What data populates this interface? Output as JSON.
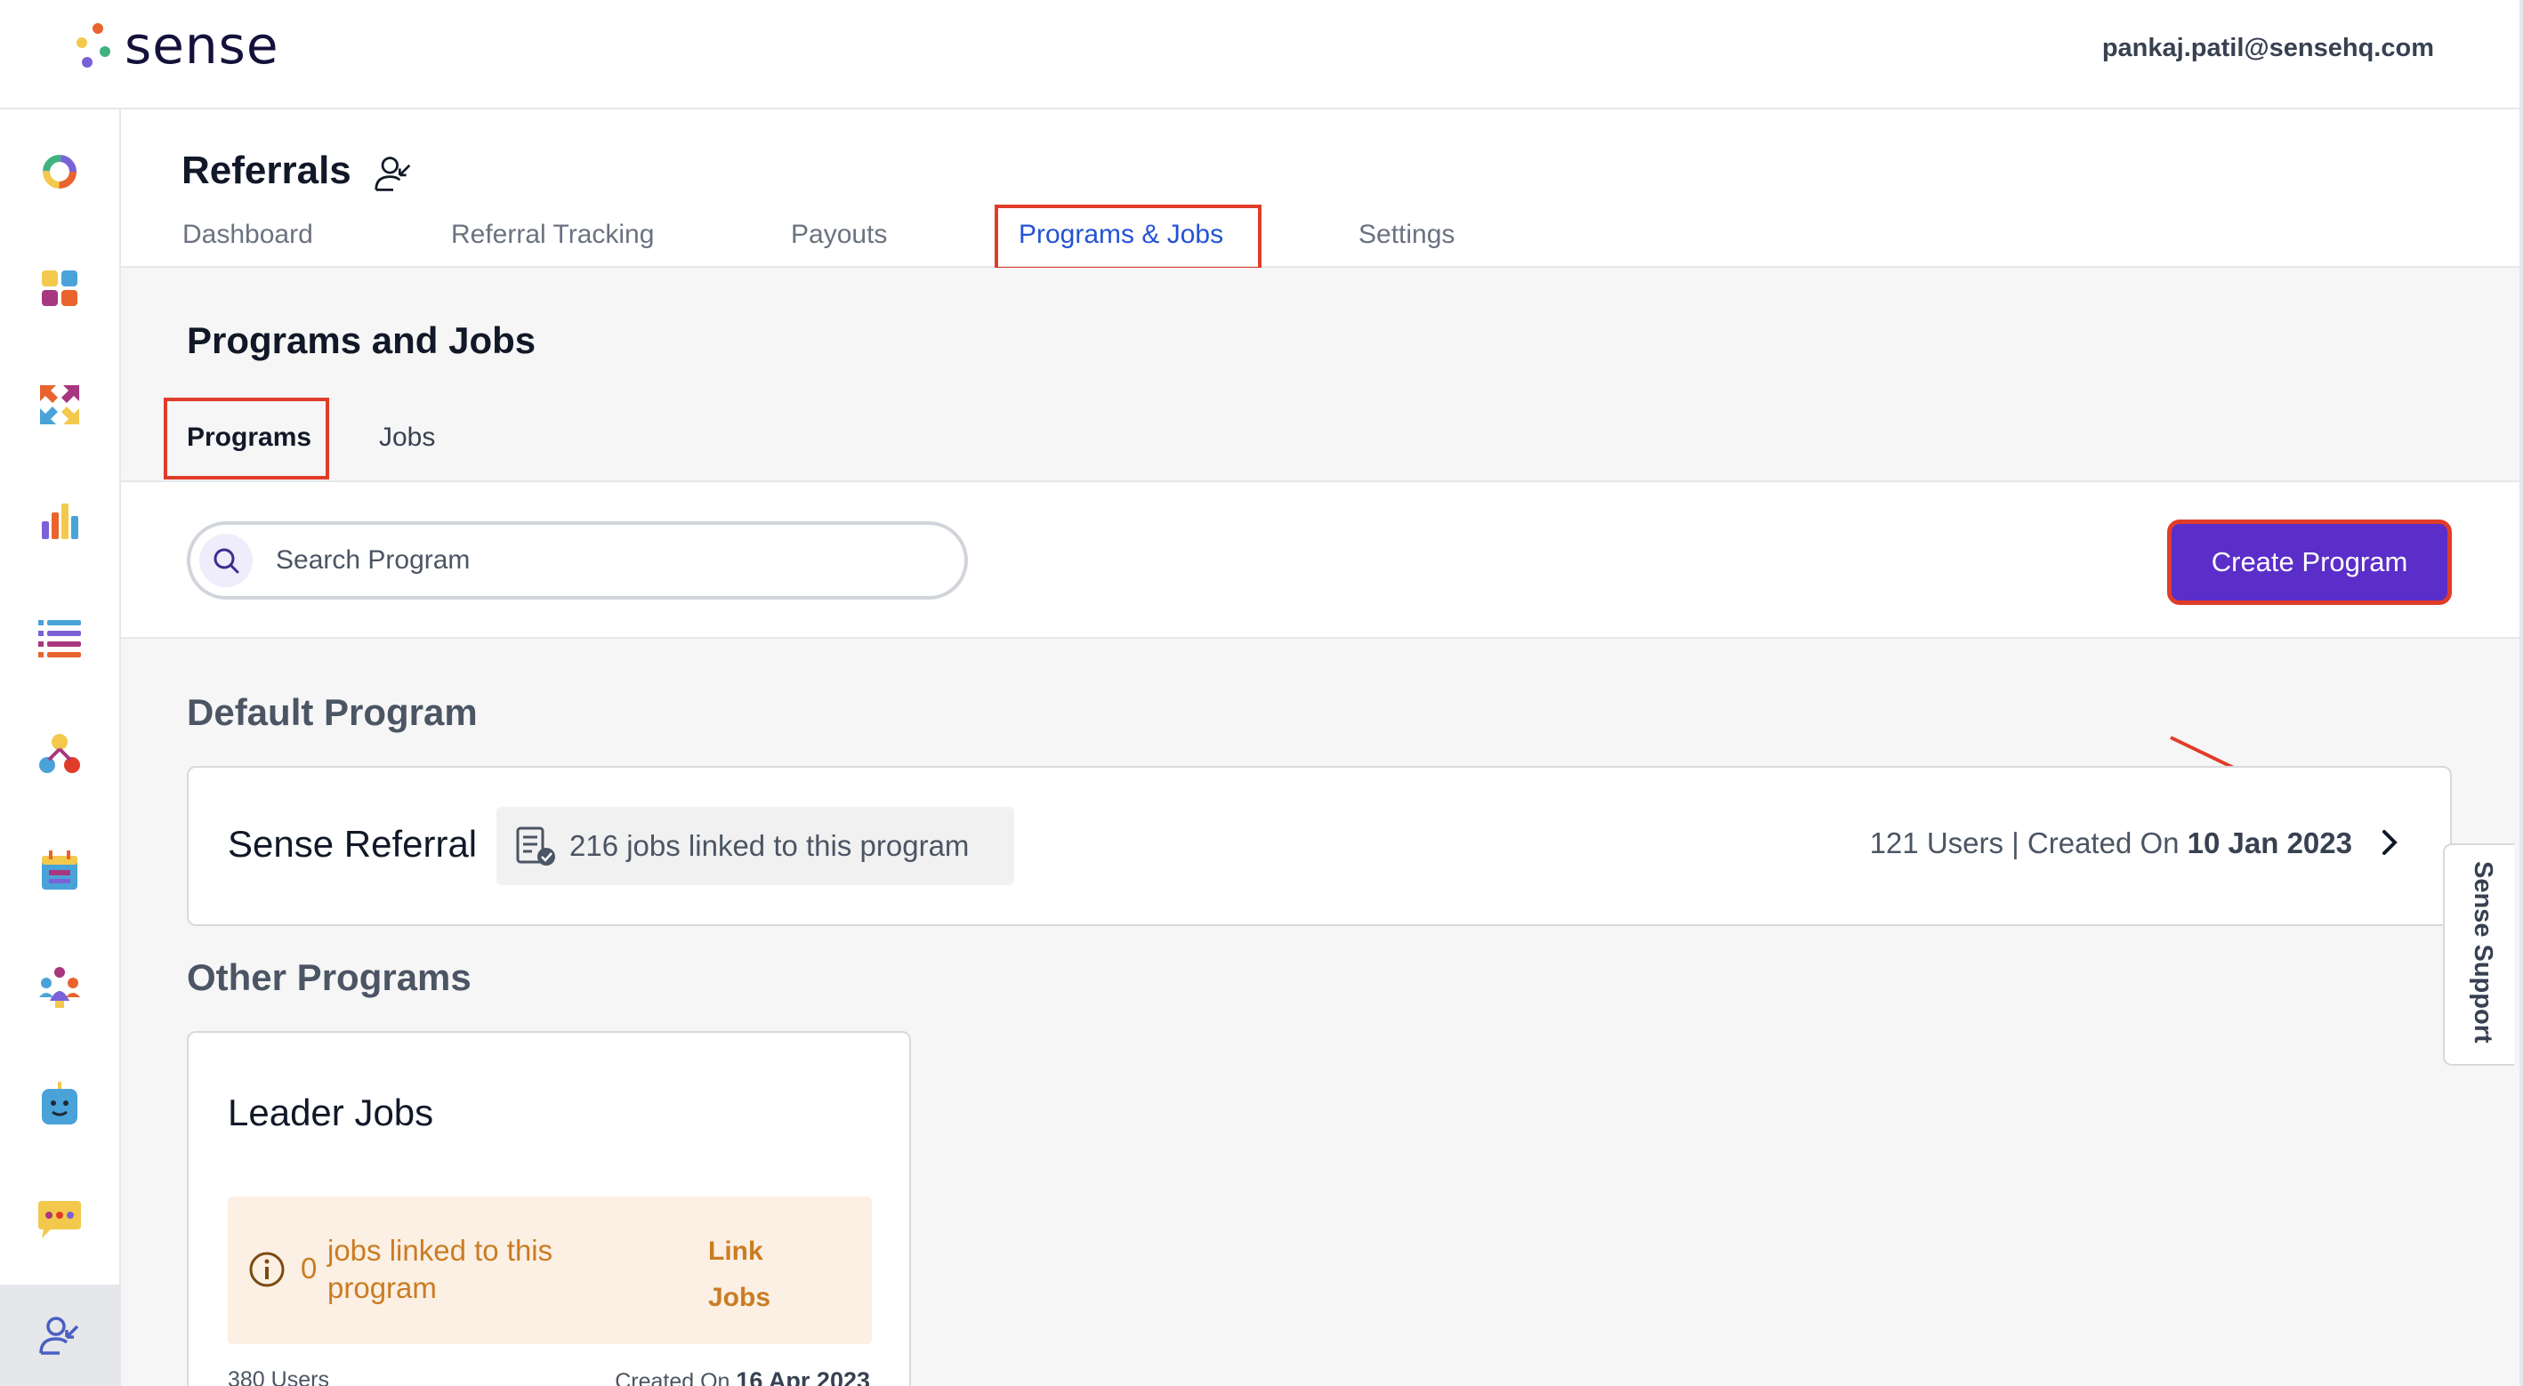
{
  "header": {
    "logo_text": "sense",
    "user_email": "pankaj.patil@sensehq.com"
  },
  "sidebar": {
    "items": [
      {
        "icon": "donut-chart-icon"
      },
      {
        "icon": "apps-grid-icon"
      },
      {
        "icon": "arrows-exchange-icon"
      },
      {
        "icon": "bar-chart-icon"
      },
      {
        "icon": "list-icon"
      },
      {
        "icon": "people-network-icon"
      },
      {
        "icon": "calendar-icon"
      },
      {
        "icon": "community-icon"
      },
      {
        "icon": "chatbot-icon"
      },
      {
        "icon": "chat-bubble-icon"
      },
      {
        "icon": "referral-user-icon",
        "active": true
      }
    ]
  },
  "page": {
    "title": "Referrals",
    "tabs": [
      "Dashboard",
      "Referral Tracking",
      "Payouts",
      "Programs & Jobs",
      "Settings"
    ],
    "active_tab": "Programs & Jobs"
  },
  "main": {
    "section_title": "Programs and Jobs",
    "subtabs": [
      "Programs",
      "Jobs"
    ],
    "active_subtab": "Programs",
    "search": {
      "placeholder": "Search Program",
      "value": ""
    },
    "create_button": "Create Program",
    "default_group_title": "Default Program",
    "default_program": {
      "name": "Sense Referral",
      "jobs_linked": "216 jobs linked to this program",
      "users": "121",
      "users_label": "Users | Created On",
      "created_on": "10 Jan 2023"
    },
    "other_group_title": "Other Programs",
    "other_programs": [
      {
        "name": "Leader Jobs",
        "jobs_count": "0",
        "jobs_text": "jobs linked to this program",
        "link_label_1": "Link",
        "link_label_2": "Jobs",
        "users": "380 Users",
        "created_label": "Created On",
        "created_on": "16 Apr 2023"
      }
    ]
  },
  "support": {
    "label": "Sense Support"
  },
  "colors": {
    "primary_button": "#5b2ec9",
    "active_tab": "#2453d3",
    "highlight_box": "#e03c2a",
    "notice_bg": "#fcefe3",
    "notice_text": "#c97d23"
  }
}
